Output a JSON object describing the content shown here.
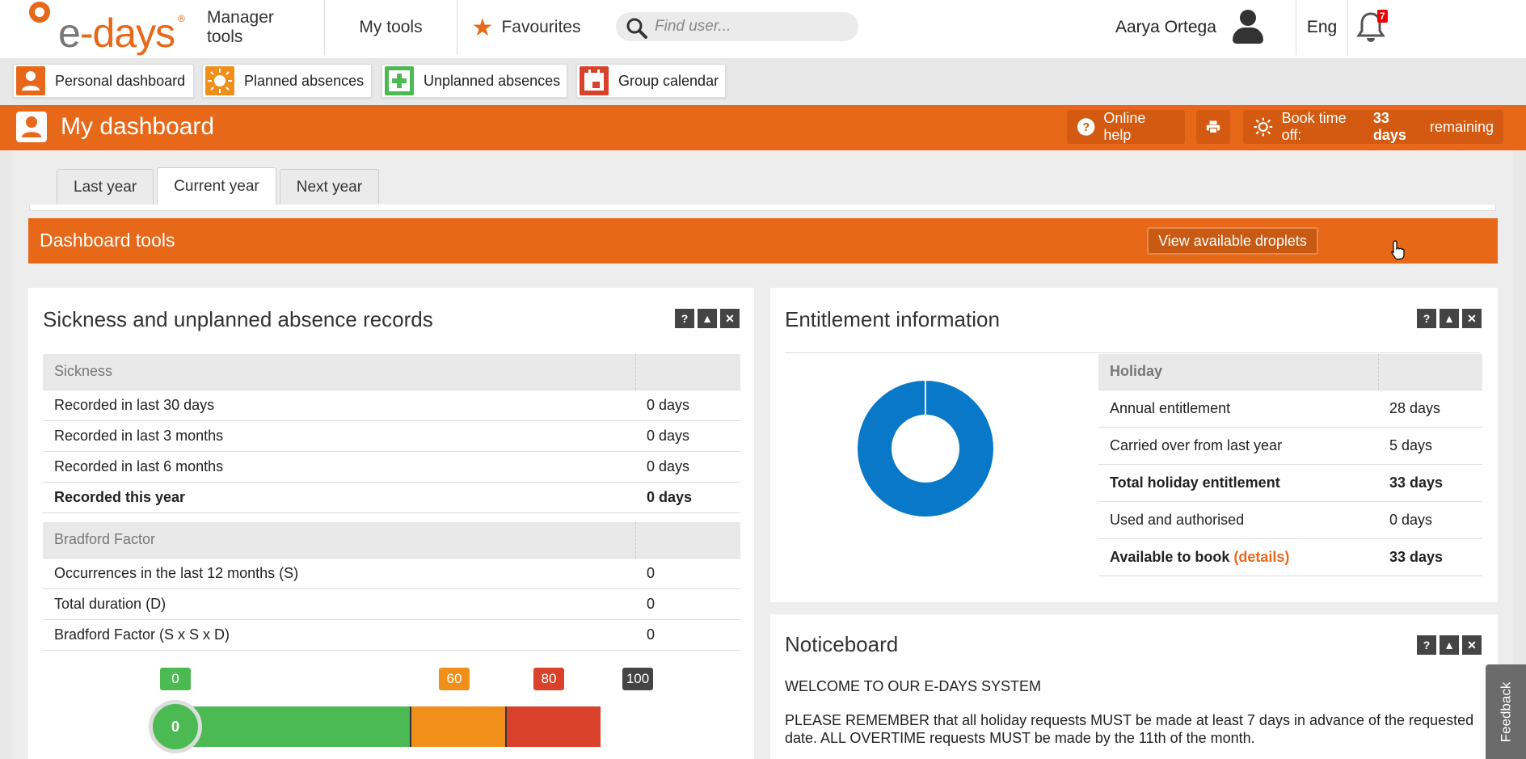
{
  "topbar": {
    "logo_text_e": "e",
    "logo_text_days": "-days",
    "logo_reg": "®",
    "nav": [
      "Manager tools",
      "My tools",
      "Favourites"
    ],
    "search_placeholder": "Find user...",
    "user_name": "Aarya Ortega",
    "language": "Eng",
    "notification_count": "7"
  },
  "quick_links": [
    "Personal dashboard",
    "Planned absences",
    "Unplanned absences",
    "Group calendar"
  ],
  "header": {
    "title": "My dashboard",
    "online_help": "Online help",
    "book_time_prefix": "Book time off:",
    "book_time_days": "33 days",
    "book_time_suffix": "remaining"
  },
  "tabs": [
    "Last year",
    "Current year",
    "Next year"
  ],
  "dashboard_tools": {
    "title": "Dashboard tools",
    "button": "View available droplets"
  },
  "sickness": {
    "title": "Sickness and unplanned absence records",
    "section1": "Sickness",
    "rows1": [
      {
        "label": "Recorded in last 30 days",
        "value": "0 days"
      },
      {
        "label": "Recorded in last 3 months",
        "value": "0 days"
      },
      {
        "label": "Recorded in last 6 months",
        "value": "0 days"
      },
      {
        "label": "Recorded this year",
        "value": "0 days"
      }
    ],
    "section2": "Bradford Factor",
    "rows2": [
      {
        "label": "Occurrences in the last 12 months (S)",
        "value": "0"
      },
      {
        "label": "Total duration (D)",
        "value": "0"
      },
      {
        "label": "Bradford Factor (S x S x D)",
        "value": "0"
      }
    ],
    "gauge": {
      "value": "0",
      "marks": [
        "0",
        "60",
        "80",
        "100"
      ]
    }
  },
  "entitlement": {
    "title": "Entitlement information",
    "section": "Holiday",
    "rows": [
      {
        "label": "Annual entitlement",
        "value": "28 days"
      },
      {
        "label": "Carried over from last year",
        "value": "5 days"
      },
      {
        "label": "Total holiday entitlement",
        "value": "33 days"
      },
      {
        "label": "Used and authorised",
        "value": "0 days"
      },
      {
        "label": "Available to book",
        "link": "(details)",
        "value": "33 days"
      }
    ],
    "chart_color": "#0a78c8"
  },
  "noticeboard": {
    "title": "Noticeboard",
    "line1": "WELCOME TO OUR E-DAYS SYSTEM",
    "line2": "PLEASE REMEMBER that all holiday requests MUST be made at least 7 days in advance of the requested date. ALL OVERTIME requests MUST be made by the 11th of the month."
  },
  "feedback": "Feedback",
  "colors": {
    "brand": "#e8681a",
    "green": "#4cba52",
    "amber": "#f0901a",
    "red": "#d9412b",
    "dark": "#444444"
  }
}
